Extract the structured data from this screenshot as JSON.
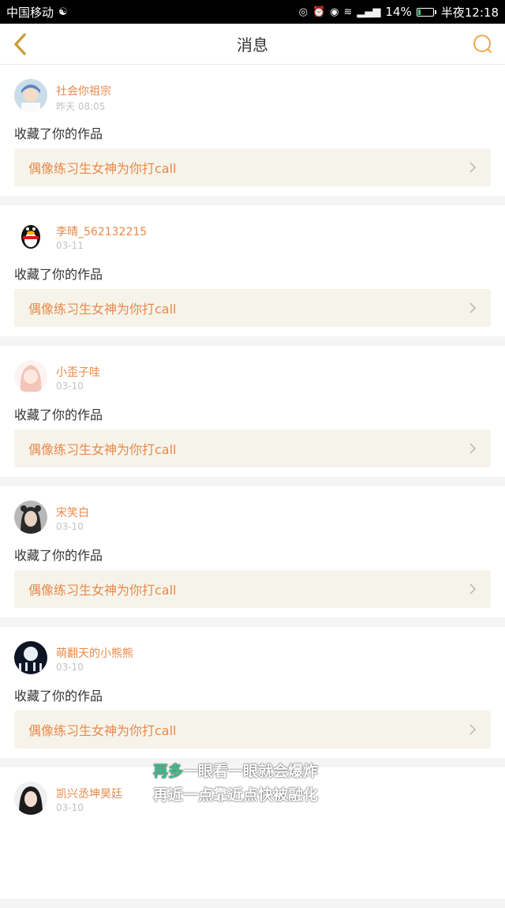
{
  "status_bar": {
    "carrier": "中国移动",
    "battery": "14%",
    "time": "半夜12:18",
    "network": "4G",
    "battery_level": 0.14
  },
  "header": {
    "title": "消息",
    "back_icon": "chevron-left-icon",
    "search_icon": "search-icon",
    "accent_color": "#c9a03c"
  },
  "notifications": [
    {
      "user": "社会你祖宗",
      "time": "昨天 08:05",
      "action": "收藏了你的作品",
      "work": "偶像练习生女神为你打call",
      "avatar": "avatar-girl-hat"
    },
    {
      "user": "李晴_562132215",
      "time": "03-11",
      "action": "收藏了你的作品",
      "work": "偶像练习生女神为你打call",
      "avatar": "avatar-penguin"
    },
    {
      "user": "小歪子哇",
      "time": "03-10",
      "action": "收藏了你的作品",
      "work": "偶像练习生女神为你打call",
      "avatar": "avatar-anime-girl"
    },
    {
      "user": "宋笑白",
      "time": "03-10",
      "action": "收藏了你的作品",
      "work": "偶像练习生女神为你打call",
      "avatar": "avatar-girl-ears"
    },
    {
      "user": "萌翻天的小熊熊",
      "time": "03-10",
      "action": "收藏了你的作品",
      "work": "偶像练习生女神为你打call",
      "avatar": "avatar-moon-night"
    },
    {
      "user": "凯兴丞坤昊廷",
      "time": "03-10",
      "action": "",
      "work": "",
      "avatar": "avatar-girl-dark-hair"
    }
  ],
  "overlay": {
    "line1_highlight": "再多",
    "line1_rest": "一眼看一眼就会爆炸",
    "line2": "再近一点靠近点快被融化"
  },
  "colors": {
    "username": "#e8894a",
    "work_link_bg": "#f6f4ea",
    "highlight": "#3bbf8a"
  }
}
